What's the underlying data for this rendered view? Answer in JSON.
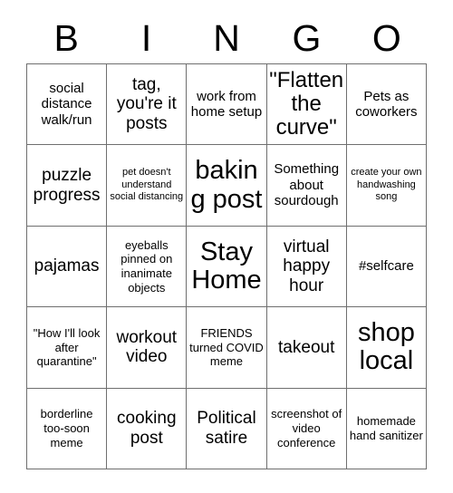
{
  "card": {
    "title_letters": [
      "B",
      "I",
      "N",
      "G",
      "O"
    ],
    "colors": {
      "background": "#ffffff",
      "text": "#000000",
      "grid_line": "#6f6f6f"
    },
    "rows": [
      [
        {
          "text": "social distance walk/run",
          "size": "m"
        },
        {
          "text": "tag, you're it posts",
          "size": "l"
        },
        {
          "text": "work from home setup",
          "size": "m"
        },
        {
          "text": "\"Flatten the curve\"",
          "size": "xl"
        },
        {
          "text": "Pets as coworkers",
          "size": "m"
        }
      ],
      [
        {
          "text": "puzzle progress",
          "size": "l"
        },
        {
          "text": "pet doesn't understand social distancing",
          "size": "xs"
        },
        {
          "text": "baking post",
          "size": "xxl"
        },
        {
          "text": "Something about sourdough",
          "size": "m"
        },
        {
          "text": "create your own handwashing song",
          "size": "xs"
        }
      ],
      [
        {
          "text": "pajamas",
          "size": "l"
        },
        {
          "text": "eyeballs pinned on inanimate objects",
          "size": "s"
        },
        {
          "text": "Stay Home",
          "size": "xxl"
        },
        {
          "text": "virtual happy hour",
          "size": "l"
        },
        {
          "text": "#selfcare",
          "size": "m"
        }
      ],
      [
        {
          "text": "\"How I'll look after quarantine\"",
          "size": "s"
        },
        {
          "text": "workout video",
          "size": "l"
        },
        {
          "text": "FRIENDS turned COVID meme",
          "size": "s"
        },
        {
          "text": "takeout",
          "size": "l"
        },
        {
          "text": "shop local",
          "size": "xxl"
        }
      ],
      [
        {
          "text": "borderline too-soon meme",
          "size": "s"
        },
        {
          "text": "cooking post",
          "size": "l"
        },
        {
          "text": "Political satire",
          "size": "l"
        },
        {
          "text": "screenshot of video conference",
          "size": "s"
        },
        {
          "text": "homemade hand sanitizer",
          "size": "s"
        }
      ]
    ]
  }
}
